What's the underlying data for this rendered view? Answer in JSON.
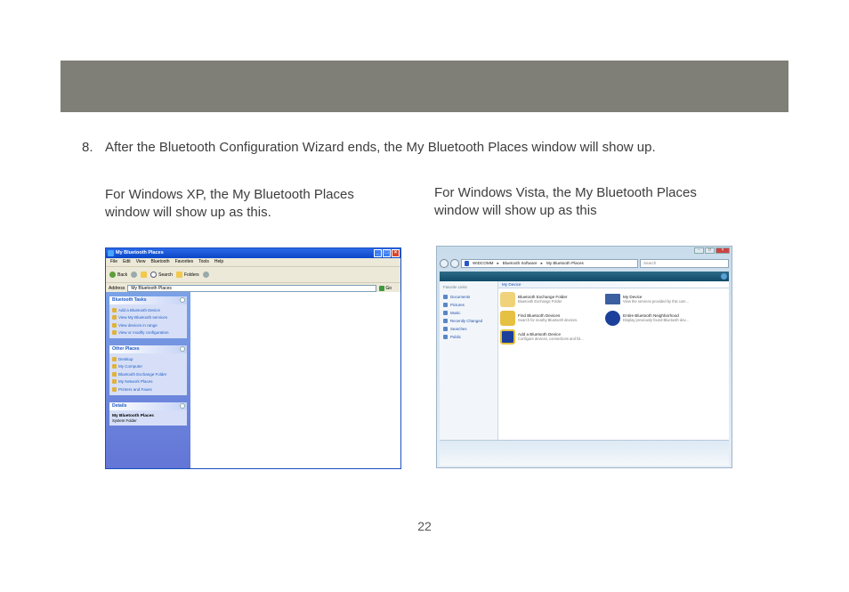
{
  "step": {
    "number": "8.",
    "text": "After the Bluetooth Configuration Wizard ends, the My Bluetooth Places window will show up."
  },
  "captions": {
    "xp": "For Windows XP, the My Bluetooth Places window will show up as this.",
    "vista": "For Windows Vista, the My Bluetooth Places window will show up as this"
  },
  "page_number": "22",
  "xp_window": {
    "title": "My Bluetooth Places",
    "menu": [
      "File",
      "Edit",
      "View",
      "Bluetooth",
      "Favorites",
      "Tools",
      "Help"
    ],
    "toolbar": {
      "back": "Back",
      "search": "Search",
      "folders": "Folders"
    },
    "address_label": "Address",
    "address_value": "My Bluetooth Places",
    "go_label": "Go",
    "panes": {
      "bluetooth_tasks": {
        "title": "Bluetooth Tasks",
        "items": [
          "Add a Bluetooth Device",
          "View My Bluetooth services",
          "View devices in range",
          "View or modify configuration"
        ]
      },
      "other_places": {
        "title": "Other Places",
        "items": [
          "Desktop",
          "My Computer",
          "Bluetooth Exchange Folder",
          "My Network Places",
          "Printers and Faxes"
        ]
      },
      "details": {
        "title": "Details",
        "name": "My Bluetooth Places",
        "type": "System Folder"
      }
    }
  },
  "vista_window": {
    "breadcrumb": [
      "WIDCOMM",
      "Bluetooth Software",
      "My Bluetooth Places"
    ],
    "search_placeholder": "Search",
    "favorite_links_label": "Favorite Links",
    "favorite_links": [
      "Documents",
      "Pictures",
      "Music",
      "Recently Changed",
      "Searches",
      "Public"
    ],
    "section_title": "My Device",
    "items": [
      {
        "title": "Bluetooth Exchange Folder",
        "sub": "Bluetooth Exchange Folder"
      },
      {
        "title": "My Device",
        "sub": "View the services provided by this com..."
      },
      {
        "title": "Find Bluetooth Devices",
        "sub": "Search for nearby Bluetooth devices."
      },
      {
        "title": "Entire Bluetooth Neighborhood",
        "sub": "Display previously found Bluetooth dev..."
      },
      {
        "title": "Add a Bluetooth Device",
        "sub": "Configure devices, connections and fol..."
      }
    ]
  },
  "colors": {
    "header_bar": "#7f7f78",
    "xp_title": "#0a46c8",
    "vista_toolbar": "#0f4a66"
  }
}
